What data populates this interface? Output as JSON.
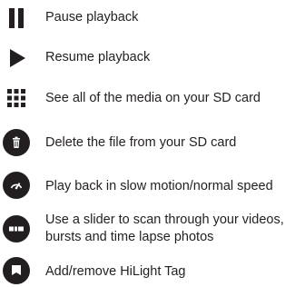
{
  "items": [
    {
      "icon": "pause-icon",
      "label": "Pause playback"
    },
    {
      "icon": "play-icon",
      "label": "Resume playback"
    },
    {
      "icon": "grid-icon",
      "label": "See all of the media on your SD card"
    },
    {
      "icon": "trash-icon",
      "label": "Delete the file from your SD card"
    },
    {
      "icon": "speed-gauge-icon",
      "label": "Play back in slow motion/normal speed"
    },
    {
      "icon": "scrub-slider-icon",
      "label_line1": "Use a slider to scan through your videos,",
      "label_line2": "bursts and time lapse photos"
    },
    {
      "icon": "hilight-tag-icon",
      "label": "Add/remove HiLight Tag"
    }
  ],
  "colors": {
    "icon": "#231f20",
    "text": "#231f20",
    "background": "#ffffff"
  }
}
